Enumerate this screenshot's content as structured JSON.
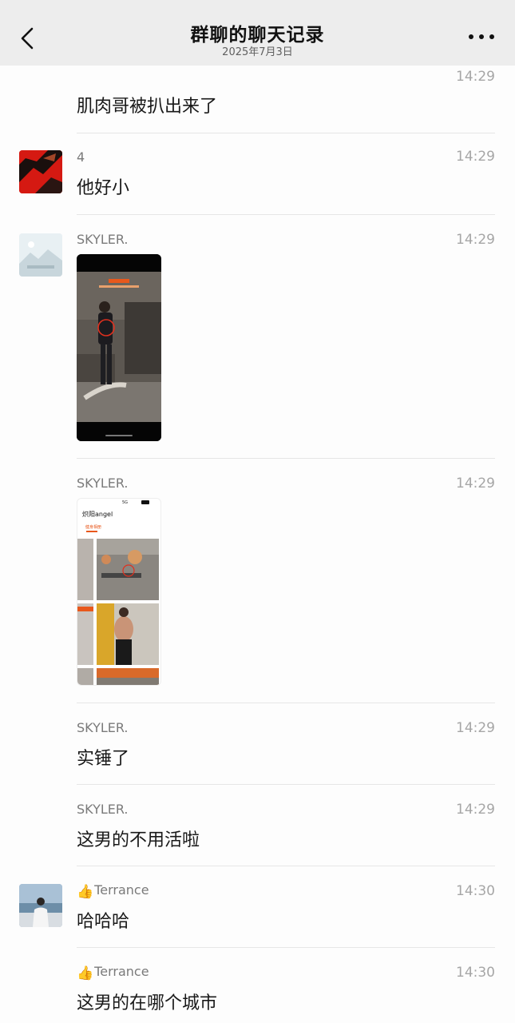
{
  "header": {
    "title": "群聊的聊天记录",
    "date": "2025年7月3日"
  },
  "messages": [
    {
      "sender": "",
      "time": "14:29",
      "text": "肌肉哥被扒出来了"
    },
    {
      "sender": "4",
      "time": "14:29",
      "text": "他好小"
    },
    {
      "sender": "SKYLER.",
      "time": "14:29",
      "attachment": "video"
    },
    {
      "sender": "SKYLER.",
      "time": "14:29",
      "attachment": "image",
      "image_text": {
        "profile_name": "炽阳angel",
        "tab": "健身相册",
        "status": "5G"
      }
    },
    {
      "sender": "SKYLER.",
      "time": "14:29",
      "text": "实锤了"
    },
    {
      "sender": "SKYLER.",
      "time": "14:29",
      "text": "这男的不用活啦"
    },
    {
      "sender": "Terrance",
      "sender_icon": "👍",
      "time": "14:30",
      "text": "哈哈哈"
    },
    {
      "sender": "Terrance",
      "sender_icon": "👍",
      "time": "14:30",
      "text": "这男的在哪个城市"
    }
  ],
  "avatars": {
    "user4": "red-black-avatar",
    "skyler": "placeholder-landscape-avatar",
    "terrance": "person-by-sea-avatar"
  },
  "colors": {
    "header_bg": "#ededed",
    "page_bg": "#fdfdfd",
    "time_text": "#a6a6a6",
    "name_text": "#7a7a7a",
    "accent_orange": "#e8581c"
  }
}
